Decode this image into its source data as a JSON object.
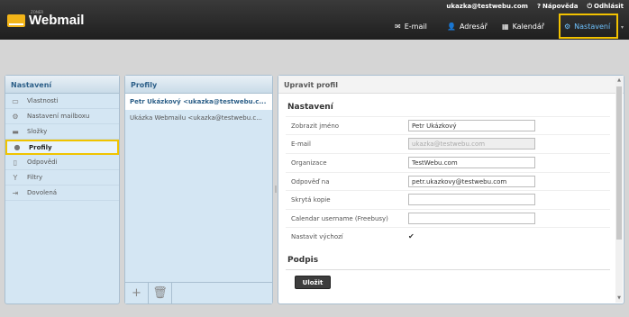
{
  "topbar": {
    "logo_sup": "ZONER",
    "logo_text": "Webmail",
    "user_email": "ukazka@testwebu.com",
    "help_label": "Nápověda",
    "logout_label": "Odhlásit",
    "nav": {
      "email": "E-mail",
      "adresar": "Adresář",
      "kalendar": "Kalendář",
      "nastaveni": "Nastavení"
    }
  },
  "left_panel": {
    "title": "Nastavení",
    "items": [
      {
        "label": "Vlastnosti",
        "icon": "laptop-icon"
      },
      {
        "label": "Nastavení mailboxu",
        "icon": "gear-icon"
      },
      {
        "label": "Složky",
        "icon": "folder-icon"
      },
      {
        "label": "Profily",
        "icon": "person-icon"
      },
      {
        "label": "Odpovědi",
        "icon": "document-icon"
      },
      {
        "label": "Filtry",
        "icon": "filter-icon"
      },
      {
        "label": "Dovolená",
        "icon": "out-of-office-icon"
      }
    ]
  },
  "mid_panel": {
    "title": "Profily",
    "profiles": [
      "Petr Ukázkový <ukazka@testwebu.c...",
      "Ukázka Webmailu <ukazka@testwebu.c..."
    ]
  },
  "right_panel": {
    "title": "Upravit profil",
    "section_settings": "Nastavení",
    "fields": [
      {
        "label": "Zobrazit jméno",
        "value": "Petr Ukázkový"
      },
      {
        "label": "E-mail",
        "value": "ukazka@testwebu.com"
      },
      {
        "label": "Organizace",
        "value": "TestWebu.com"
      },
      {
        "label": "Odpověď na",
        "value": "petr.ukazkovy@testwebu.com"
      },
      {
        "label": "Skrytá kopie",
        "value": ""
      },
      {
        "label": "Calendar username (Freebusy)",
        "value": ""
      },
      {
        "label": "Nastavit výchozí",
        "value": "✔"
      }
    ],
    "section_signature": "Podpis",
    "save_label": "Uložit"
  },
  "colors": {
    "accent": "#f2c200",
    "topbar": "#2a2a2a",
    "panel_bg": "#d4e6f3",
    "header_text": "#2c5f88"
  }
}
